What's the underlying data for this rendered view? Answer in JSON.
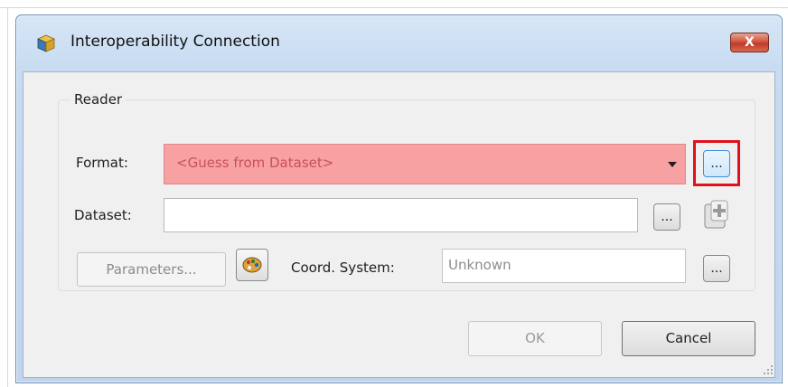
{
  "window": {
    "title": "Interoperability Connection",
    "close_glyph": "X",
    "icon": "cube-app-icon"
  },
  "reader": {
    "group_title": "Reader",
    "format_label": "Format:",
    "format_value": "<Guess from Dataset>",
    "format_button_label": "...",
    "dataset_label": "Dataset:",
    "dataset_value": "",
    "dataset_button_label": "...",
    "add_dataset_icon": "add-dataset-icon",
    "parameters_button": "Parameters...",
    "coord_label": "Coord. System:",
    "coord_value": "Unknown",
    "coord_button_label": "..."
  },
  "buttons": {
    "ok": "OK",
    "cancel": "Cancel"
  },
  "colors": {
    "format_invalid_bg": "#f7a1a3",
    "highlight": "#e0101e",
    "focus": "#3c8fe0"
  }
}
